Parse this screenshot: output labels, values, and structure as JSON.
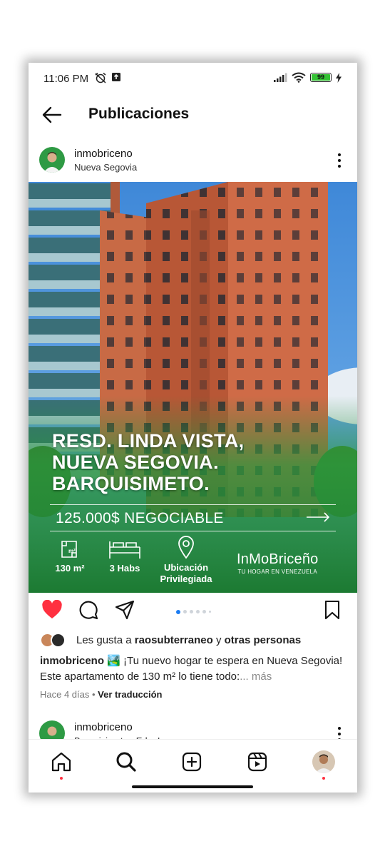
{
  "status_bar": {
    "time": "11:06 PM",
    "battery": "99"
  },
  "header": {
    "title": "Publicaciones"
  },
  "post": {
    "username": "inmobriceno",
    "location": "Nueva Segovia",
    "image": {
      "headline_lines": [
        "RESD. LINDA VISTA,",
        "NUEVA SEGOVIA.",
        "BARQUISIMETO."
      ],
      "price": "125.000$ NEGOCIABLE",
      "features": [
        {
          "icon": "area-icon",
          "label": "130 m²"
        },
        {
          "icon": "bed-icon",
          "label": "3 Habs"
        },
        {
          "icon": "location-pin-icon",
          "label_line1": "Ubicación",
          "label_line2": "Privilegiada"
        }
      ],
      "brand_name": "InMoBriceño",
      "brand_tagline": "TU HOGAR EN VENEZUELA"
    },
    "carousel": {
      "count": 6,
      "active_index": 0
    },
    "likes": {
      "prefix": "Les gusta a ",
      "user": "raosubterraneo",
      "middle": " y ",
      "others": "otras personas"
    },
    "caption": {
      "username": "inmobriceno",
      "emoji": "🏞️",
      "text": " ¡Tu nuevo hogar te espera en Nueva Segovia! Este apartamento de 130 m² lo tiene todo:",
      "more": "... más"
    },
    "time_ago": "Hace 4 días",
    "separator": " • ",
    "translate": "Ver traducción"
  },
  "next_post": {
    "username": "inmobriceno",
    "location": "Barquisimeto , Edo. Lara"
  },
  "colors": {
    "like_red": "#ff3040",
    "brand_green": "#1f8a3a",
    "carousel_active": "#1b7cf2"
  },
  "nav": [
    "home-icon",
    "search-icon",
    "create-icon",
    "reels-icon",
    "profile-avatar"
  ]
}
